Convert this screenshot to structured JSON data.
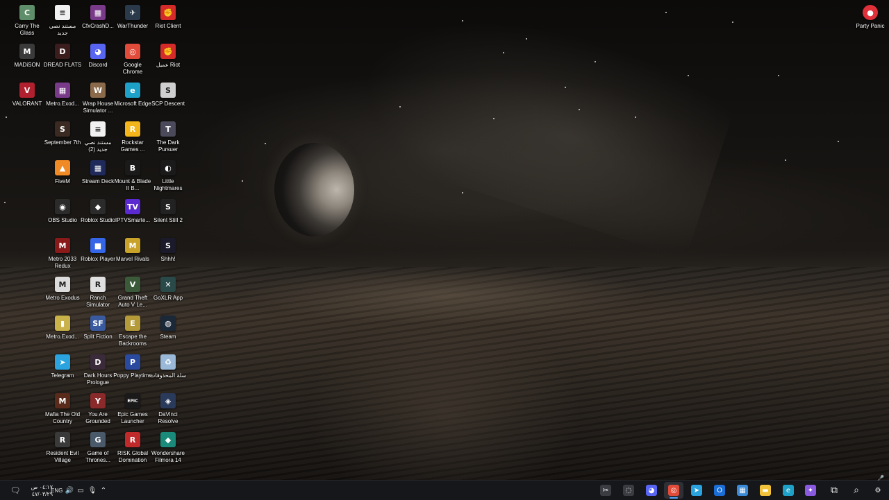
{
  "desktop": {
    "icons": [
      {
        "label": "Carry The Glass",
        "icon": "carry-the-glass-icon",
        "color": "#5f8e6a",
        "glyph": "C"
      },
      {
        "label": "MADiSON",
        "icon": "madison-icon",
        "color": "#3a3a3a",
        "glyph": "M"
      },
      {
        "label": "VALORANT",
        "icon": "valorant-icon",
        "color": "#b0202e",
        "glyph": "V"
      },
      {
        "label": "مستند نصي جديد",
        "icon": "text-document-icon",
        "color": "#f1f1f1",
        "glyph": "≡"
      },
      {
        "label": "DREAD FLATS",
        "icon": "dread-flats-icon",
        "color": "#3b1d1d",
        "glyph": "D"
      },
      {
        "label": "Metro.Exod...",
        "icon": "metro-exodus-installer-icon",
        "color": "#7a3a8a",
        "glyph": "▦"
      },
      {
        "label": "September 7th",
        "icon": "september-7th-icon",
        "color": "#3a2a22",
        "glyph": "S"
      },
      {
        "label": "FiveM",
        "icon": "fivem-icon",
        "color": "#f08a24",
        "glyph": "▲"
      },
      {
        "label": "OBS Studio",
        "icon": "obs-studio-icon",
        "color": "#2b2b2b",
        "glyph": "◉"
      },
      {
        "label": "Metro 2033 Redux",
        "icon": "metro-2033-redux-icon",
        "color": "#8a1a1a",
        "glyph": "M"
      },
      {
        "label": "Metro Exodus",
        "icon": "metro-exodus-icon",
        "color": "#dcdcdc",
        "glyph": "M"
      },
      {
        "label": "Metro.Exod...",
        "icon": "metro-exodus-file-icon",
        "color": "#c9b24a",
        "glyph": "▮"
      },
      {
        "label": "Telegram",
        "icon": "telegram-icon",
        "color": "#2aa3df",
        "glyph": "➤"
      },
      {
        "label": "Mafia The Old Country",
        "icon": "mafia-old-country-icon",
        "color": "#5a2a1a",
        "glyph": "M"
      },
      {
        "label": "Resident Evil Village",
        "icon": "resident-evil-village-icon",
        "color": "#3a3a3a",
        "glyph": "R"
      },
      {
        "label": "CfxCrashD...",
        "icon": "cfx-crash-dump-icon",
        "color": "#7a3a8a",
        "glyph": "▦"
      },
      {
        "label": "Discord",
        "icon": "discord-icon",
        "color": "#5865f2",
        "glyph": "◕"
      },
      {
        "label": "Wrap House Simulator ...",
        "icon": "wrap-house-simulator-icon",
        "color": "#8a6a4a",
        "glyph": "W"
      },
      {
        "label": "مستند نصي جديد (2)",
        "icon": "text-document-2-icon",
        "color": "#f1f1f1",
        "glyph": "≡"
      },
      {
        "label": "Stream Deck",
        "icon": "stream-deck-icon",
        "color": "#1f2a5a",
        "glyph": "▦"
      },
      {
        "label": "Roblox Studio",
        "icon": "roblox-studio-icon",
        "color": "#2b2b2b",
        "glyph": "◆"
      },
      {
        "label": "Roblox Player",
        "icon": "roblox-player-icon",
        "color": "#3566e8",
        "glyph": "■"
      },
      {
        "label": "Ranch Simulator",
        "icon": "ranch-simulator-icon",
        "color": "#e0e0e0",
        "glyph": "R"
      },
      {
        "label": "Split Fiction",
        "icon": "split-fiction-icon",
        "color": "#3a5aa0",
        "glyph": "SF"
      },
      {
        "label": "Dark Hours Prologue",
        "icon": "dark-hours-icon",
        "color": "#3a2a3a",
        "glyph": "D"
      },
      {
        "label": "You Are Grounded",
        "icon": "you-are-grounded-icon",
        "color": "#8a2a2a",
        "glyph": "Y"
      },
      {
        "label": "Game of Thrones...",
        "icon": "game-of-thrones-icon",
        "color": "#4a5a6a",
        "glyph": "G"
      },
      {
        "label": "WarThunder",
        "icon": "warthunder-icon",
        "color": "#2a3a4a",
        "glyph": "✈"
      },
      {
        "label": "Google Chrome",
        "icon": "google-chrome-icon",
        "color": "#e04b3a",
        "glyph": "◎"
      },
      {
        "label": "Microsoft Edge",
        "icon": "microsoft-edge-icon",
        "color": "#1da1c8",
        "glyph": "e"
      },
      {
        "label": "Rockstar Games ...",
        "icon": "rockstar-games-icon",
        "color": "#f2b51a",
        "glyph": "R"
      },
      {
        "label": "Mount & Blade II B...",
        "icon": "mount-blade-icon",
        "color": "#1a1a1a",
        "glyph": "B"
      },
      {
        "label": "IPTVSmarte...",
        "icon": "iptv-smarters-icon",
        "color": "#5a2ad0",
        "glyph": "TV"
      },
      {
        "label": "Marvel Rivals",
        "icon": "marvel-rivals-icon",
        "color": "#c9a22a",
        "glyph": "M"
      },
      {
        "label": "Grand Theft Auto V Le...",
        "icon": "gta-v-icon",
        "color": "#3a5a3a",
        "glyph": "V"
      },
      {
        "label": "Escape the Backrooms",
        "icon": "escape-backrooms-icon",
        "color": "#b59a3a",
        "glyph": "E"
      },
      {
        "label": "Poppy Playtime",
        "icon": "poppy-playtime-icon",
        "color": "#2a4aa0",
        "glyph": "P"
      },
      {
        "label": "Epic Games Launcher",
        "icon": "epic-games-icon",
        "color": "#1a1a1a",
        "glyph": "EPIC"
      },
      {
        "label": "RISK Global Domination",
        "icon": "risk-icon",
        "color": "#c02a2a",
        "glyph": "R"
      },
      {
        "label": "Riot Client",
        "icon": "riot-client-icon",
        "color": "#d42a2a",
        "glyph": "✊"
      },
      {
        "label": "عميل Riot",
        "icon": "riot-client-ar-icon",
        "color": "#d42a2a",
        "glyph": "✊"
      },
      {
        "label": "SCP Descent",
        "icon": "scp-descent-icon",
        "color": "#cfcfcf",
        "glyph": "S"
      },
      {
        "label": "The Dark Pursuer",
        "icon": "dark-pursuer-icon",
        "color": "#4a4a5a",
        "glyph": "T"
      },
      {
        "label": "Little Nightmares",
        "icon": "little-nightmares-icon",
        "color": "#1a1a1a",
        "glyph": "◐"
      },
      {
        "label": "Silent Still 2",
        "icon": "silent-still-icon",
        "color": "#222222",
        "glyph": "S"
      },
      {
        "label": "Shhh!",
        "icon": "shhh-icon",
        "color": "#1a1a2a",
        "glyph": "S"
      },
      {
        "label": "GoXLR App",
        "icon": "goxlr-icon",
        "color": "#2a4a4a",
        "glyph": "✕"
      },
      {
        "label": "Steam",
        "icon": "steam-icon",
        "color": "#1b2838",
        "glyph": "◍"
      },
      {
        "label": "سلة المحذوفات",
        "icon": "recycle-bin-icon",
        "color": "#9ab8d8",
        "glyph": "♻"
      },
      {
        "label": "DaVinci Resolve",
        "icon": "davinci-resolve-icon",
        "color": "#2a3a5a",
        "glyph": "◈"
      },
      {
        "label": "Wondershare Filmora 14",
        "icon": "filmora-icon",
        "color": "#1a8a7a",
        "glyph": "◆"
      }
    ],
    "right_icon": {
      "label": "Party Panic",
      "icon": "party-panic-icon",
      "color": "#e0303a",
      "glyph": "●"
    }
  },
  "taskbar": {
    "date": "٤٧/٠٣/٢٩",
    "time": "٠٤:١٧ ص",
    "language": "ENG",
    "apps": [
      {
        "name": "snip-tool-icon",
        "color": "#3a3c42",
        "glyph": "✂"
      },
      {
        "name": "app-circle-icon",
        "color": "#3a3c42",
        "glyph": "◌"
      },
      {
        "name": "discord-taskbar-icon",
        "color": "#5865f2",
        "glyph": "◕"
      },
      {
        "name": "chrome-taskbar-icon",
        "color": "#e04b3a",
        "glyph": "◎"
      },
      {
        "name": "telegram-taskbar-icon",
        "color": "#2aa3df",
        "glyph": "➤"
      },
      {
        "name": "outlook-taskbar-icon",
        "color": "#1a6ed8",
        "glyph": "O"
      },
      {
        "name": "store-taskbar-icon",
        "color": "#3a8ad8",
        "glyph": "▦"
      },
      {
        "name": "file-explorer-taskbar-icon",
        "color": "#f2c23a",
        "glyph": "▬"
      },
      {
        "name": "edge-taskbar-icon",
        "color": "#1da1c8",
        "glyph": "e"
      },
      {
        "name": "copilot-taskbar-icon",
        "color": "#8a5ae0",
        "glyph": "✦"
      },
      {
        "name": "task-view-icon",
        "color": "transparent",
        "glyph": "⧉"
      },
      {
        "name": "search-icon",
        "color": "transparent",
        "glyph": "⌕"
      },
      {
        "name": "start-icon",
        "color": "transparent",
        "glyph": "⊞"
      }
    ]
  }
}
